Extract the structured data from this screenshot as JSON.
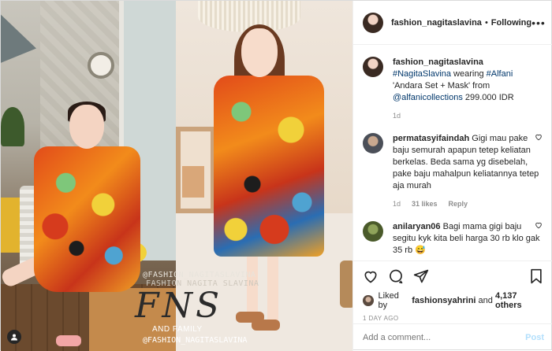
{
  "post": {
    "author": "fashion_nagitaslavina",
    "follow_label": "Following",
    "more_label": "•••",
    "caption": {
      "username": "fashion_nagitaslavina",
      "tag1": "#NagitaSlavina",
      "text1": " wearing ",
      "tag2": "#Alfani",
      "text2": " 'Andara Set + Mask' from ",
      "mention": "@alfanicollections",
      "text3": " 299.000 IDR",
      "time": "1d"
    },
    "comments": [
      {
        "username": "permatasyifaindah",
        "text": "Gigi mau pake baju semurah apapun tetep keliatan berkelas. Beda sama yg disebelah, pake baju mahalpun keliatannya tetep aja murah",
        "time": "1d",
        "likes": "31 likes",
        "reply": "Reply"
      },
      {
        "username": "anilaryan06",
        "text": "Bagi mama gigi baju segitu kyk kita beli harga 30 rb klo gak 35 rb 😅"
      }
    ],
    "likes_text_prefix": "Liked by ",
    "liked_by": "fashionsyahrini",
    "likes_and": " and ",
    "likes_others": "4,137 others",
    "date": "1 DAY AGO",
    "add_comment_placeholder": "Add a comment...",
    "post_button": "Post"
  },
  "watermark": {
    "top": "@FASHION_NAGITASLAVINA",
    "top2": "FASHION NAGITA SLAVINA",
    "logo": "FNS",
    "bottom": "AND FAMILY",
    "bottom2": "@FASHION_NAGITASLAVINA"
  },
  "icons": [
    "heart-icon",
    "comment-icon",
    "share-icon",
    "bookmark-icon",
    "user-tag-icon",
    "more-icon"
  ]
}
